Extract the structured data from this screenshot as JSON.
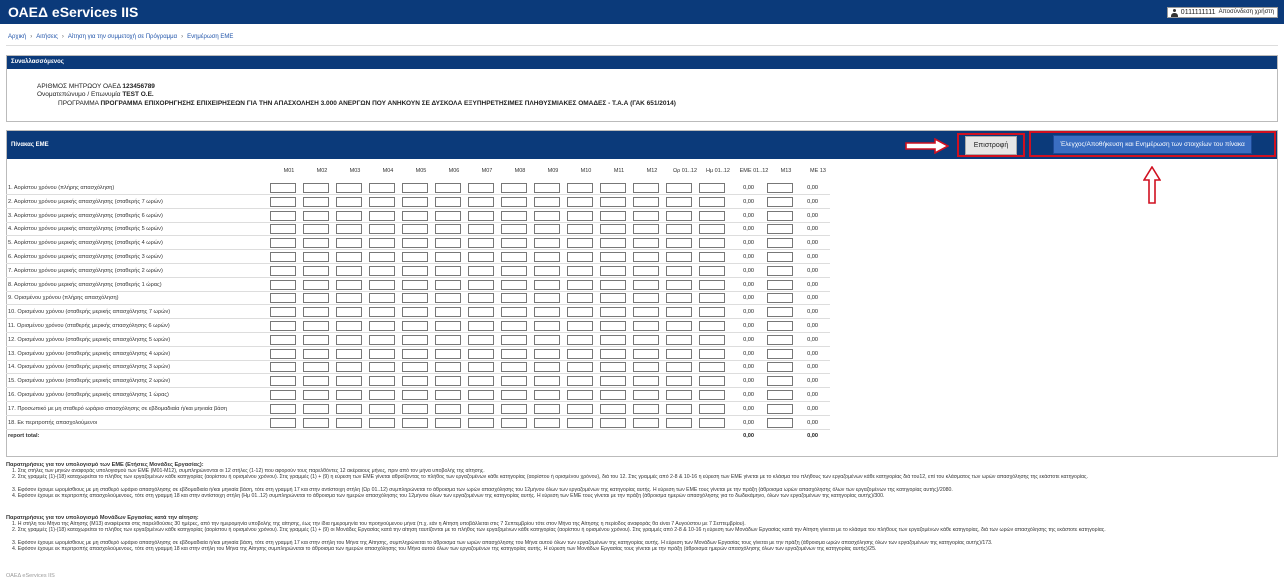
{
  "header": {
    "brand": "ΟΑΕΔ eServices IIS",
    "user_id": "0111111111",
    "logout": "Αποσύνδεση χρήστη",
    "icon": "user-icon"
  },
  "breadcrumb": [
    "Αρχική",
    "Αιτήσεις",
    "Αίτηση για την συμμετοχή σε Πρόγραμμα",
    "Ενημέρωση ΕΜΕ"
  ],
  "transactor": {
    "title": "Συναλλασσόμενος",
    "ame_label": "ΑΡΙΘΜΟΣ ΜΗΤΡΩΟΥ ΟΑΕΔ",
    "ame_value": "123456789",
    "name_label": "Ονοματεπώνυμο / Επωνυμία",
    "name_value": "TEST Ο.Ε.",
    "program_label": "ΠΡΟΓΡΑΜΜΑ",
    "program_value": "ΠΡΟΓΡΑΜΜΑ ΕΠΙΧΟΡΗΓΗΣΗΣ ΕΠΙΧΕΙΡΗΣΕΩΝ ΓΙΑ ΤΗΝ ΑΠΑΣΧΟΛΗΣΗ 3.000 ΑΝΕΡΓΩΝ ΠΟΥ ΑΝΗΚΟΥΝ ΣΕ ΔΥΣΚΟΛΑ ΕΞΥΠΗΡΕΤΗΣΙΜΕΣ ΠΛΗΘΥΣΜΙΑΚΕΣ ΟΜΑΔΕΣ - Τ.Α.Α (ΓΑΚ 651/2014)"
  },
  "eme": {
    "title": "Πίνακας ΕΜΕ",
    "back_button": "Επιστροφή",
    "save_button": "Έλεγχος/Αποθήκευση και Ενημέρωση των στοιχείων του πίνακα",
    "columns": [
      "M01",
      "M02",
      "M03",
      "M04",
      "M05",
      "M06",
      "M07",
      "M08",
      "M09",
      "M10",
      "M11",
      "M12",
      "Ωρ 01..12",
      "Ημ 01..12",
      "ΕΜΕ 01..12",
      "M13",
      "ΜΕ 13"
    ],
    "rows": [
      {
        "label": "1. Αορίστου χρόνου (πλήρης απασχόληση)",
        "eme": "0,00",
        "me13": "0,00"
      },
      {
        "label": "2. Αορίστου χρόνου μερικής απασχόλησης (σταθερής 7 ωρών)",
        "eme": "0,00",
        "me13": "0,00"
      },
      {
        "label": "3. Αορίστου χρόνου μερικής απασχόλησης (σταθερής 6 ωρών)",
        "eme": "0,00",
        "me13": "0,00"
      },
      {
        "label": "4. Αορίστου χρόνου μερικής απασχόλησης (σταθερής 5 ωρών)",
        "eme": "0,00",
        "me13": "0,00"
      },
      {
        "label": "5. Αορίστου χρόνου μερικής απασχόλησης (σταθερής 4 ωρών)",
        "eme": "0,00",
        "me13": "0,00"
      },
      {
        "label": "6. Αορίστου χρόνου μερικής απασχόλησης (σταθερής 3 ωρών)",
        "eme": "0,00",
        "me13": "0,00"
      },
      {
        "label": "7. Αορίστου χρόνου μερικής απασχόλησης (σταθερής 2 ωρών)",
        "eme": "0,00",
        "me13": "0,00"
      },
      {
        "label": "8. Αορίστου χρόνου μερικής απασχόλησης (σταθερής 1 ώρας)",
        "eme": "0,00",
        "me13": "0,00"
      },
      {
        "label": "9. Ορισμένου χρόνου (πλήρης απασχόληση)",
        "eme": "0,00",
        "me13": "0,00"
      },
      {
        "label": "10. Ορισμένου χρόνου (σταθερής μερικής απασχόλησης 7 ωρών)",
        "eme": "0,00",
        "me13": "0,00"
      },
      {
        "label": "11. Ορισμένου χρόνου (σταθερής μερικής απασχόλησης 6 ωρών)",
        "eme": "0,00",
        "me13": "0,00"
      },
      {
        "label": "12. Ορισμένου χρόνου (σταθερής μερικής απασχόλησης 5 ωρών)",
        "eme": "0,00",
        "me13": "0,00"
      },
      {
        "label": "13. Ορισμένου χρόνου (σταθερής μερικής απασχόλησης 4 ωρών)",
        "eme": "0,00",
        "me13": "0,00"
      },
      {
        "label": "14. Ορισμένου χρόνου (σταθερής μερικής απασχόλησης 3 ωρών)",
        "eme": "0,00",
        "me13": "0,00"
      },
      {
        "label": "15. Ορισμένου χρόνου (σταθερής μερικής απασχόλησης 2 ωρών)",
        "eme": "0,00",
        "me13": "0,00"
      },
      {
        "label": "16. Ορισμένου χρόνου (σταθερής μερικής απασχόλησης 1 ώρας)",
        "eme": "0,00",
        "me13": "0,00"
      },
      {
        "label": "17. Προσωπικό με μη σταθερό ωράριο απασχόλησης σε εβδομαδιαία ή/και μηνιαία βάση",
        "eme": "0,00",
        "me13": "0,00"
      },
      {
        "label": "18. Εκ περιτροπής απασχολούμενοι",
        "eme": "0,00",
        "me13": "0,00"
      }
    ],
    "report_label": "report total:",
    "report_eme": "0,00",
    "report_me13": "0,00"
  },
  "notes": {
    "title1": "Παρατηρήσεις για τον υπολογισμό των ΕΜΕ (Ετήσιες Μονάδες Εργασίας):",
    "items1": [
      "1. Στις στήλες των μηνών αναφοράς υπολογισμού των ΕΜΕ (Μ01-Μ12), συμπληρώνονται οι 12 στήλες (1-12) που αφορούν τους παρελθόντες 12 ακέραιους μήνες, πριν από τον μήνα υποβολής της αίτησης.",
      "2. Στις γραμμές (1)-(18) καταχωρείται το πλήθος των εργαζομένων κάθε κατηγορίας (αορίστου ή ορισμένου χρόνου). Στις γραμμές (1) + (9) η εύρεση των ΕΜΕ γίνεται αθροίζοντας το πλήθος των εργαζομένων κάθε κατηγορίας (αορίστου ή ορισμένου χρόνου), διά του 12. Στις γραμμές από 2-8 & 10-16 η εύρεση των ΕΜΕ γίνεται με το κλάσμα του πλήθους των εργαζομένων κάθε κατηγορίας διά του12, επί του κλάσματος των ωρών απασχόλησης της εκάστοτε κατηγορίας.",
      "3. Εφόσον έχουμε ωρομίσθιους με μη σταθερό ωράριο απασχόλησης σε εβδομαδιαία ή/και μηνιαία βάση, τότε στη γραμμή 17 και στην αντίστοιχη στήλη (Ωρ 01..12) συμπληρώνεται το άθροισμα των ωρών απασχόλησης του 12μήνου όλων των εργαζομένων της κατηγορίας αυτής. Η εύρεση των ΕΜΕ τους γίνεται με την πράξη (άθροισμα ωρών απασχόλησης όλων των εργαζομένων της κατηγορίας αυτής)/2080.",
      "4. Εφόσον έχουμε εκ περιτροπής απασχολούμενους, τότε στη γραμμή 18 και στην αντίστοιχη στήλη (Ημ 01..12) συμπληρώνεται το άθροισμα των ημερών απασχόλησης του 12μήνου όλων των εργαζομένων της κατηγορίας αυτής. Η εύρεση των ΕΜΕ τους γίνεται με την πράξη (άθροισμα ημερών απασχόλησης για το δωδεκάμηνο, όλων των εργαζομένων της κατηγορίας αυτής)/300."
    ],
    "title2": "Παρατηρήσεις για τον υπολογισμό Μονάδων Εργασίας κατά την αίτηση:",
    "items2": [
      "1. Η στήλη του Μήνα της Αίτησης (Μ13) αναφέρεται στις παρελθούσες 30 ημέρες, από την ημερομηνία υποβολής της αίτησης, έως την ίδια ημερομηνία του προηγούμενου μήνα (π.χ. εάν η Αίτηση υποβάλλεται στις 7 Σεπτεμβρίου τότε στον Μήνα της Αίτησης η περίοδος αναφοράς θα είναι 7 Αυγούστου με 7 Σεπτεμβρίου).",
      "2. Στις γραμμές (1)-(18) καταχωρείται το πλήθος των εργαζομένων κάθε κατηγορίας (αορίστου ή ορισμένου χρόνου). Στις γραμμές (1) + (9) οι Μονάδες Εργασίας κατά την αίτηση ταυτίζονται με το πλήθος των εργαζομένων κάθε κατηγορίας (αορίστου ή ορισμένου χρόνου). Στις γραμμές από 2-8 & 10-16 η εύρεση των Μονάδων Εργασίας κατά την Αίτηση γίνεται με το κλάσμα του πλήθους των εργαζομένων κάθε κατηγορίας, διά των ωρών απασχόλησης της εκάστοτε κατηγορίας.",
      "3. Εφόσον έχουμε ωρομίσθιους με μη σταθερό ωράριο απασχόλησης σε εβδομαδιαία ή/και μηνιαία βάση, τότε στη γραμμή 17 και στην στήλη του Μήνα της Αίτησης, συμπληρώνεται το άθροισμα των ωρών απασχόλησης του Μήνα αυτού όλων των εργαζομένων της κατηγορίας αυτής. Η εύρεση των Μονάδων Εργασίας τους γίνεται με την πράξη (άθροισμα ωρών απασχόλησης όλων των εργαζομένων της κατηγορίας αυτής)/173.",
      "4. Εφόσον έχουμε εκ περιτροπής απασχολούμενους, τότε στη γραμμή 18 και στην στήλη του Μήνα της Αίτησης συμπληρώνεται το άθροισμα των ημερών απασχόλησης του Μήνα αυτού όλων των εργαζομένων της κατηγορίας αυτής. Η εύρεση των Μονάδων Εργασίας τους γίνεται με την πράξη (άθροισμα ημερών απασχόλησης όλων των εργαζομένων της κατηγορίας αυτής)/25."
    ]
  },
  "footer": "ΟΑΕΔ eServices IIS",
  "colors": {
    "header_bg": "#0b3a7a",
    "highlight": "#d01020",
    "save_bg": "#3a6ec2"
  }
}
